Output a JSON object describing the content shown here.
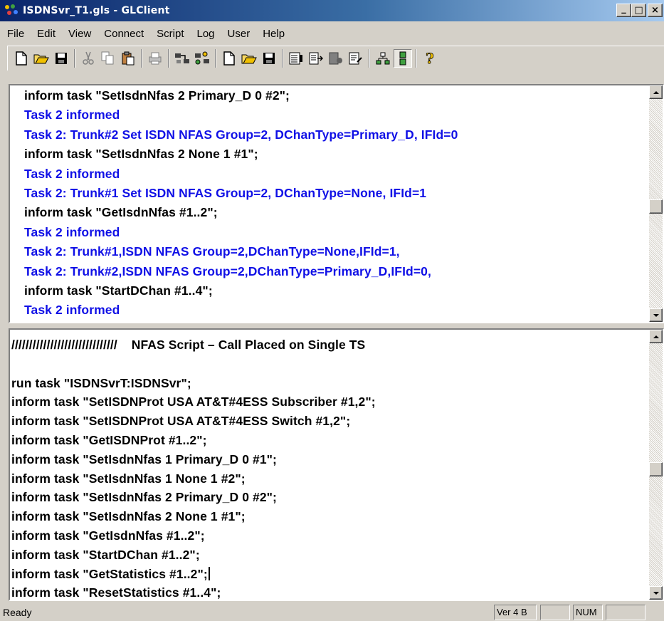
{
  "window": {
    "title": "ISDNSvr_T1.gls - GLClient",
    "minimize_label": "_",
    "maximize_label": "□",
    "close_label": "×"
  },
  "menu": [
    "File",
    "Edit",
    "View",
    "Connect",
    "Script",
    "Log",
    "User",
    "Help"
  ],
  "toolbar_icons": [
    "new-file",
    "open-folder",
    "save",
    "cut",
    "copy",
    "paste",
    "print",
    "connect",
    "connect-users",
    "new-script",
    "open-script",
    "save-script",
    "log-view",
    "log-export",
    "log-stop",
    "log-edit",
    "tree-view",
    "split-pane",
    "help"
  ],
  "log": {
    "lines": [
      {
        "text": "inform task \"SetIsdnNfas 2 Primary_D 0 #2\";",
        "kind": "cmd"
      },
      {
        "text": "Task 2 informed",
        "kind": "resp"
      },
      {
        "text": "Task 2: Trunk#2 Set ISDN NFAS Group=2, DChanType=Primary_D, IFId=0",
        "kind": "resp"
      },
      {
        "text": "inform task \"SetIsdnNfas 2 None 1 #1\";",
        "kind": "cmd"
      },
      {
        "text": "Task 2 informed",
        "kind": "resp"
      },
      {
        "text": "Task 2: Trunk#1 Set ISDN NFAS Group=2, DChanType=None, IFId=1",
        "kind": "resp"
      },
      {
        "text": "inform task \"GetIsdnNfas #1..2\";",
        "kind": "cmd"
      },
      {
        "text": "Task 2 informed",
        "kind": "resp"
      },
      {
        "text": "Task 2: Trunk#1,ISDN NFAS Group=2,DChanType=None,IFId=1,",
        "kind": "resp"
      },
      {
        "text": "Task 2: Trunk#2,ISDN NFAS Group=2,DChanType=Primary_D,IFId=0,",
        "kind": "resp"
      },
      {
        "text": "inform task \"StartDChan #1..4\";",
        "kind": "cmd"
      },
      {
        "text": "Task 2 informed",
        "kind": "resp"
      }
    ]
  },
  "script": {
    "lines": [
      "//////////////////////////////    NFAS Script – Call Placed on Single TS",
      "",
      "run task \"ISDNSvrT:ISDNSvr\";",
      "inform task \"SetISDNProt USA AT&T#4ESS Subscriber #1,2\";",
      "inform task \"SetISDNProt USA AT&T#4ESS Switch #1,2\";",
      "inform task \"GetISDNProt #1..2\";",
      "inform task \"SetIsdnNfas 1 Primary_D 0 #1\";",
      "inform task \"SetIsdnNfas 1 None 1 #2\";",
      "inform task \"SetIsdnNfas 2 Primary_D 0 #2\";",
      "inform task \"SetIsdnNfas 2 None 1 #1\";",
      "inform task \"GetIsdnNfas #1..2\";",
      "inform task \"StartDChan #1..2\";",
      "inform task \"GetStatistics #1..2\";",
      "inform task \"ResetStatistics #1..4\";"
    ],
    "caret_line": 12
  },
  "status": {
    "ready": "Ready",
    "version": "Ver 4 B",
    "panel2": "",
    "num": "NUM",
    "panel4": ""
  },
  "colors": {
    "command_text": "#000000",
    "response_text": "#1010e6",
    "titlebar_start": "#0a246a"
  }
}
